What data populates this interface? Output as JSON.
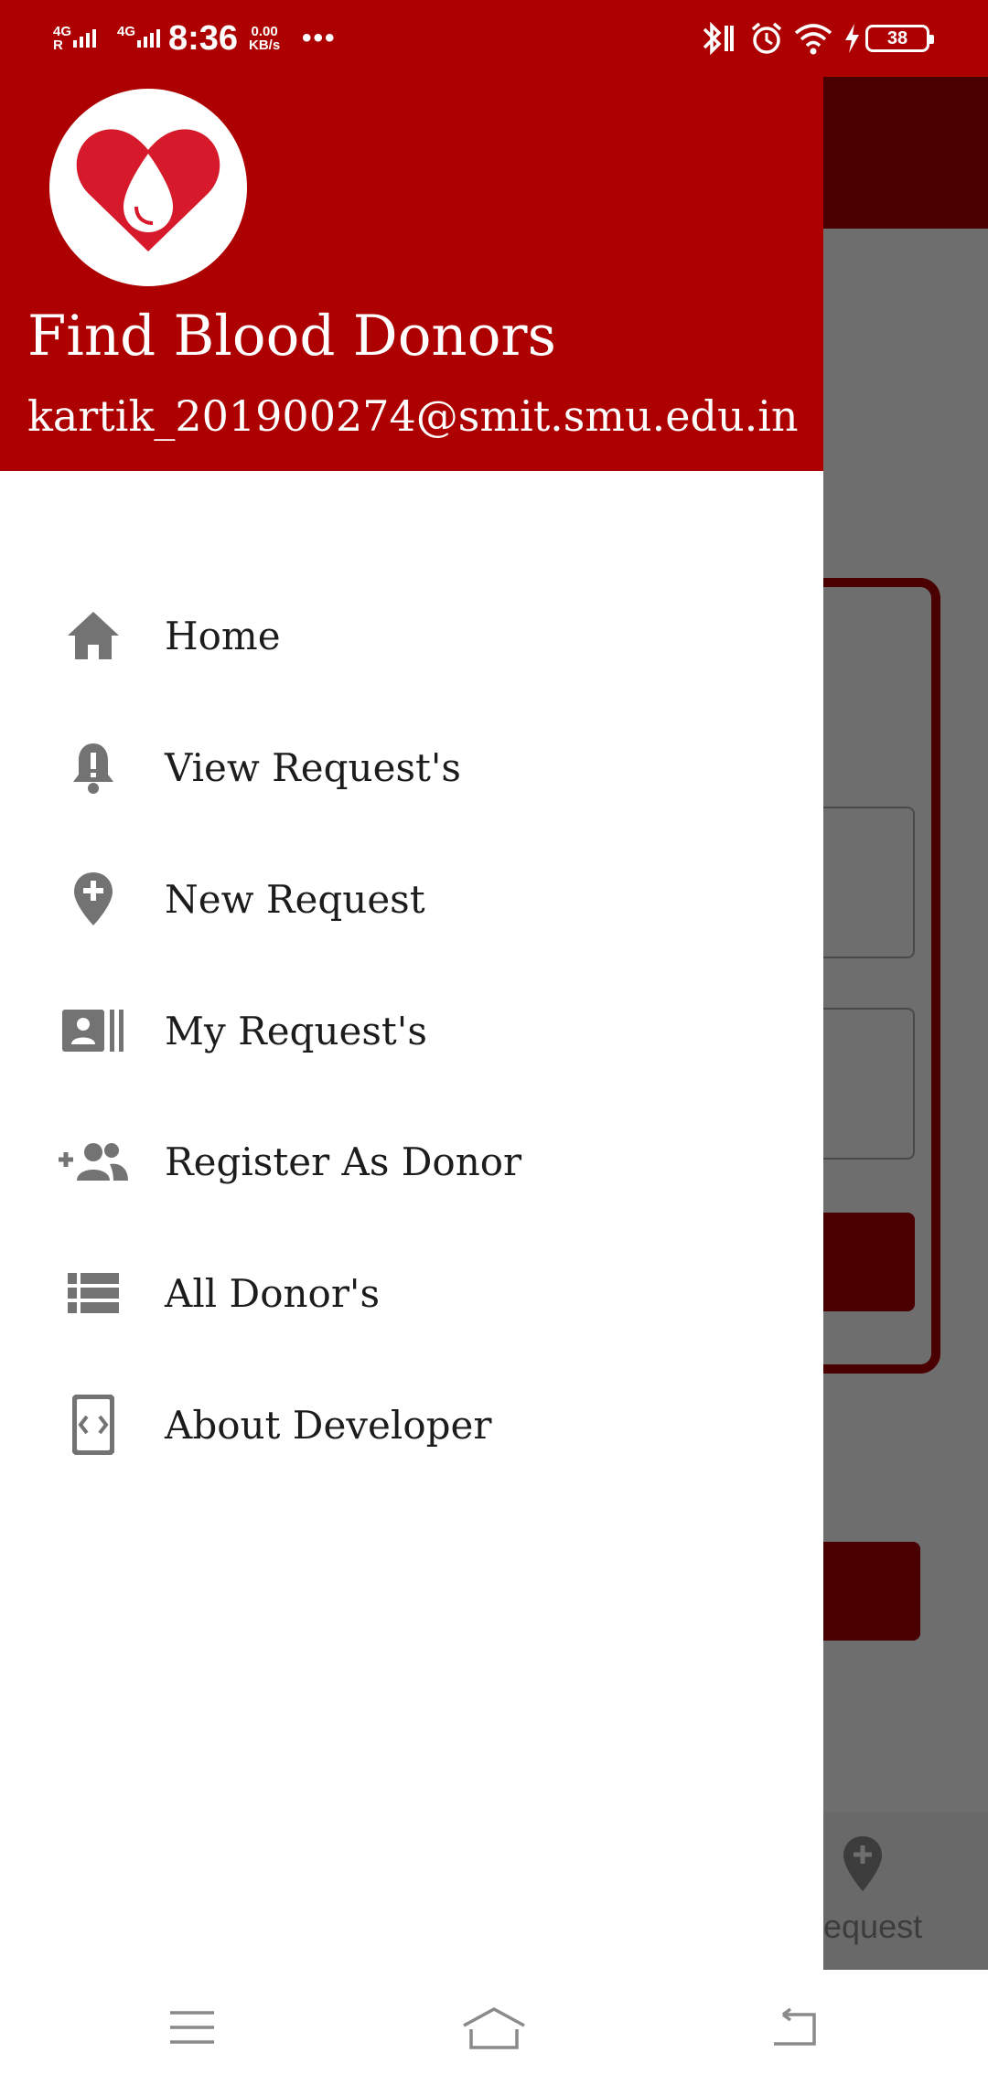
{
  "status_bar": {
    "network_1": "4G",
    "network_1_sub": "R",
    "network_2": "4G",
    "time": "8:36",
    "speed_value": "0.00",
    "speed_unit": "KB/s",
    "more": "•••",
    "battery": "38"
  },
  "drawer": {
    "header": {
      "title": "Find Blood Donors",
      "email": "kartik_201900274@smit.smu.edu.in",
      "brand_color": "#ad0000"
    },
    "items": [
      {
        "label": "Home",
        "icon": "home-icon"
      },
      {
        "label": "View Request's",
        "icon": "notification-alert-icon"
      },
      {
        "label": "New Request",
        "icon": "add-location-icon"
      },
      {
        "label": "My Request's",
        "icon": "contact-card-icon"
      },
      {
        "label": "Register As Donor",
        "icon": "group-add-icon"
      },
      {
        "label": "All Donor's",
        "icon": "list-icon"
      },
      {
        "label": "About Developer",
        "icon": "developer-mode-icon"
      }
    ]
  },
  "background_app": {
    "bottom_nav_label": "equest"
  },
  "system_nav": {
    "buttons": [
      "menu-icon",
      "home-icon",
      "back-icon"
    ]
  }
}
